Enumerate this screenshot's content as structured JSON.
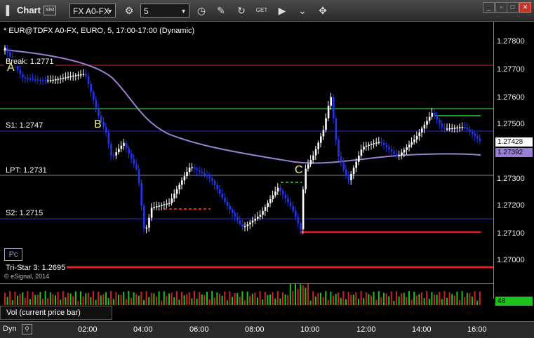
{
  "window": {
    "title": "Chart",
    "sim_badge": "SIM",
    "symbol_field": "FX A0-FX",
    "interval_field": "5"
  },
  "toolbar_icons": [
    "gear-icon",
    "clock-icon",
    "pencil-icon",
    "refresh-icon",
    "get-icon",
    "play-icon",
    "dropdown-icon",
    "cursor-icon"
  ],
  "header": "* EUR@TDFX A0-FX, EURO, 5, 17:00-17:00 (Dynamic)",
  "levels": [
    {
      "label": "Break: 1.2771",
      "price": 1.2771,
      "color": "#d33030"
    },
    {
      "label": "S1: 1.2747",
      "price": 1.2747,
      "color": "#2b2bd0"
    },
    {
      "label": "LPT: 1.2731",
      "price": 1.2731,
      "color": "#9a9a9a"
    },
    {
      "label": "S2: 1.2715",
      "price": 1.2715,
      "color": "#2b2bd0"
    },
    {
      "label": "Tri-Star 3: 1.2695",
      "price": 1.2695,
      "color": "#e02020"
    }
  ],
  "price_axis": [
    "1.27800",
    "1.27700",
    "1.27600",
    "1.27500",
    "1.27400",
    "1.27300",
    "1.27200",
    "1.27100",
    "1.27000"
  ],
  "price_badges": {
    "last": "1.27428",
    "ma": "1.27392",
    "last_color": "#ffffff",
    "ma_color": "#9b7fd4"
  },
  "time_axis": [
    "02:00",
    "04:00",
    "06:00",
    "08:00",
    "10:00",
    "12:00",
    "14:00",
    "16:00"
  ],
  "points": [
    "A",
    "B",
    "C"
  ],
  "pc_label": "Pc",
  "copyright": "© eSignal, 2014",
  "volume": {
    "label": "Vol (current price bar)",
    "value": "48"
  },
  "bottom": {
    "dyn": "Dyn"
  }
}
